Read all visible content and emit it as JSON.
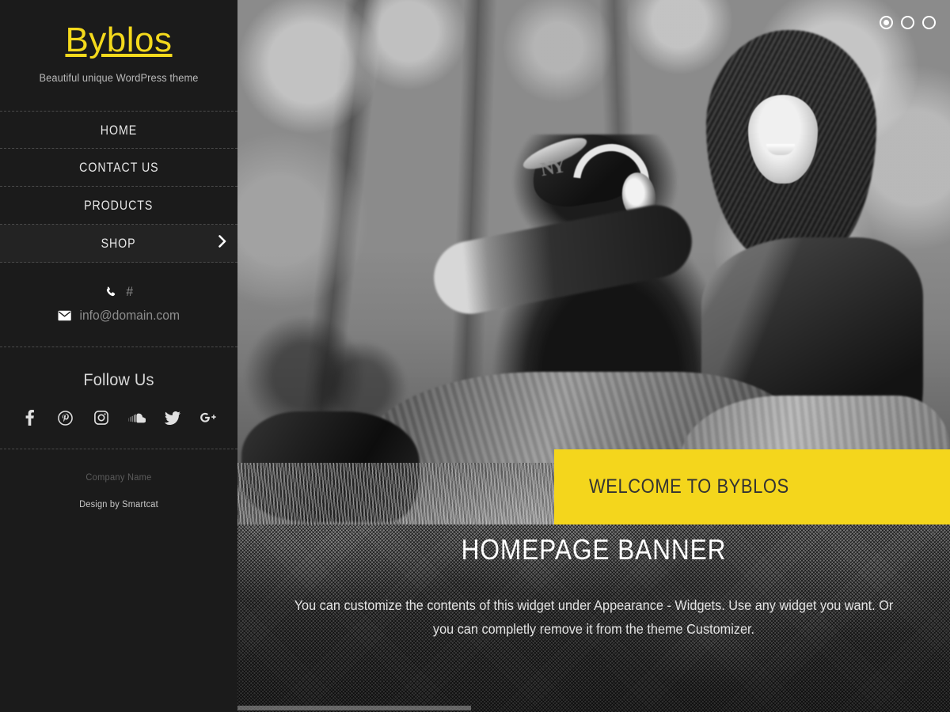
{
  "sidebar": {
    "site_title": "Byblos",
    "tagline": "Beautiful unique WordPress theme",
    "nav": [
      {
        "label": "HOME",
        "active": false,
        "has_submenu": false
      },
      {
        "label": "CONTACT US",
        "active": false,
        "has_submenu": false
      },
      {
        "label": "PRODUCTS",
        "active": false,
        "has_submenu": false
      },
      {
        "label": "SHOP",
        "active": true,
        "has_submenu": true
      }
    ],
    "contact": {
      "phone_icon": "phone-icon",
      "phone": "#",
      "email_icon": "envelope-icon",
      "email": "info@domain.com"
    },
    "follow": {
      "heading": "Follow Us",
      "socials": [
        {
          "name": "facebook-icon",
          "label": "Facebook"
        },
        {
          "name": "pinterest-icon",
          "label": "Pinterest"
        },
        {
          "name": "instagram-icon",
          "label": "Instagram"
        },
        {
          "name": "soundcloud-icon",
          "label": "SoundCloud"
        },
        {
          "name": "twitter-icon",
          "label": "Twitter"
        },
        {
          "name": "googleplus-icon",
          "label": "Google Plus"
        }
      ]
    },
    "footer": {
      "company_name": "Company Name",
      "design_by": "Design by Smartcat"
    }
  },
  "hero": {
    "caption": "WELCOME TO BYBLOS",
    "slides_total": 3,
    "active_slide": 1,
    "dots": [
      "1",
      "2",
      "3"
    ]
  },
  "banner": {
    "title": "HOMEPAGE BANNER",
    "text": "You can customize the contents of this widget under Appearance - Widgets. Use any widget you want. Or you can completly remove it from the theme Customizer."
  },
  "colors": {
    "accent_yellow": "#f4d61c",
    "sidebar_bg": "#1b1b1b",
    "caption_text": "#333333"
  }
}
